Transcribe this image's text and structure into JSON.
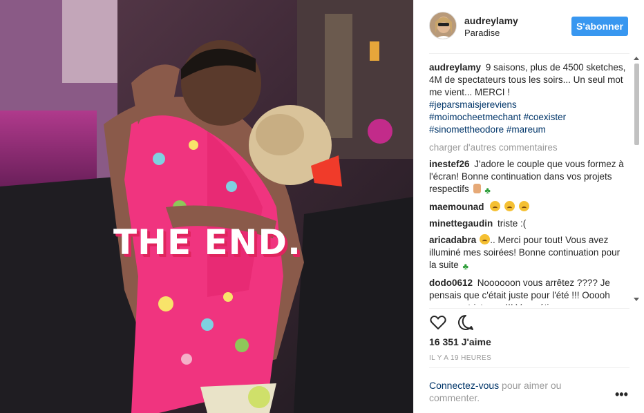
{
  "photo": {
    "overlay_text": "THE END."
  },
  "header": {
    "username": "audreylamy",
    "location": "Paradise",
    "follow_label": "S'abonner"
  },
  "caption": {
    "user": "audreylamy",
    "text": "9 saisons, plus de 4500 sketches, 4M de spectateurs tous les soirs... Un seul mot me vient... MERCI !",
    "hashtags": [
      "#jeparsmaisjereviens",
      "#moimocheetmechant #coexister",
      "#sinomettheodore #mareum"
    ]
  },
  "load_more_label": "charger d'autres commentaires",
  "comments": [
    {
      "user": "inestef26",
      "text": "J'adore le couple que vous formez à l'écran! Bonne continuation dans vos projets respectifs",
      "emojis": [
        "hand-icon",
        "clover-icon"
      ]
    },
    {
      "user": "maemounad",
      "text": "",
      "emojis": [
        "crying-face-icon",
        "crying-face-icon",
        "crying-face-icon"
      ]
    },
    {
      "user": "minettegaudin",
      "text": "triste :(",
      "emojis": []
    },
    {
      "user": "aricadabra",
      "text": ".. Merci pour tout! Vous avez illuminé mes soirées! Bonne continuation pour la suite",
      "emojis": [
        "crying-face-icon",
        "clover-icon"
      ]
    },
    {
      "user": "dodo0612",
      "text": "Noooooon vous arrêtez ???? Je pensais que c'était juste pour l'été !!! Ooooh nooooon tristesse !!! Vous étiez",
      "emojis": []
    }
  ],
  "likes_text": "16 351 J'aime",
  "time_ago": "IL Y A 19 HEURES",
  "login": {
    "link": "Connectez-vous",
    "rest": " pour aimer ou commenter."
  },
  "colors": {
    "accent": "#3897f0",
    "link": "#003569",
    "muted": "#999999",
    "overlay_shadow": "#e0245e"
  }
}
